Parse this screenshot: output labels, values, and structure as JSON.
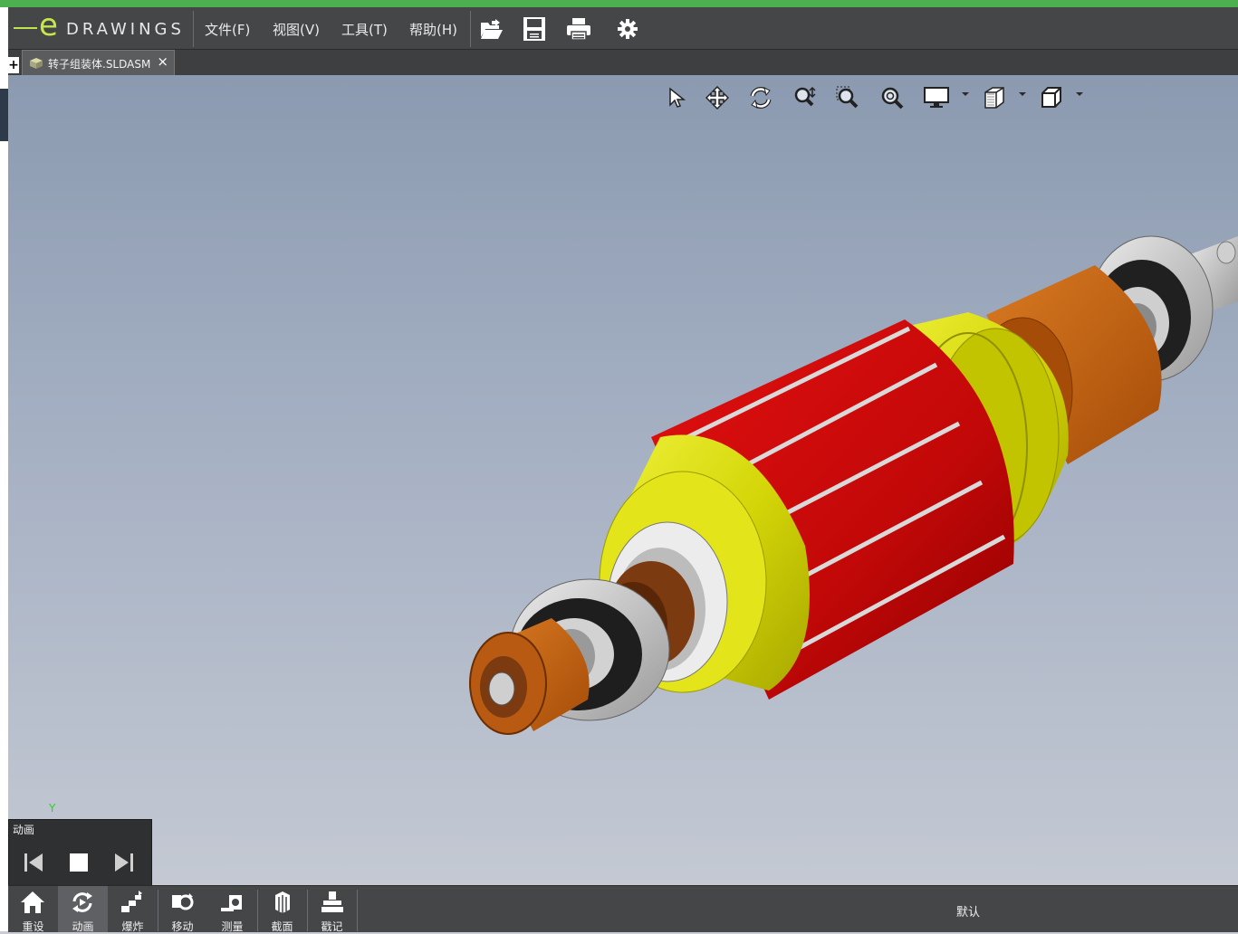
{
  "app": {
    "logo_text": "DRAWINGS",
    "logo_letter": "e"
  },
  "menu": {
    "items": [
      "文件(F)",
      "视图(V)",
      "工具(T)",
      "帮助(H)"
    ]
  },
  "toolbar": {
    "icons": [
      "open-icon",
      "save-icon",
      "print-icon",
      "settings-icon"
    ]
  },
  "tabs": {
    "add_label": "+",
    "items": [
      {
        "label": "转子组装体.SLDASM",
        "close": "×"
      }
    ]
  },
  "view_tools": [
    "select-icon",
    "pan-icon",
    "rotate-icon",
    "zoom-icon",
    "zoom-to-area-icon",
    "zoom-to-fit-icon",
    "display-style-icon",
    "shading-icon",
    "view-orientation-icon"
  ],
  "triad": {
    "y_label": "Y"
  },
  "animation_panel": {
    "title": "动画",
    "buttons": [
      "previous-icon",
      "stop-icon",
      "next-icon"
    ]
  },
  "bottom_tools": [
    {
      "label": "重设",
      "icon": "home-icon"
    },
    {
      "label": "动画",
      "icon": "animate-icon"
    },
    {
      "label": "爆炸",
      "icon": "explode-icon"
    },
    {
      "label": "移动",
      "icon": "move-icon"
    },
    {
      "label": "测量",
      "icon": "measure-icon"
    },
    {
      "label": "截面",
      "icon": "section-icon"
    },
    {
      "label": "戳记",
      "icon": "stamp-icon"
    }
  ],
  "configuration": "默认",
  "colors": {
    "accent": "#c6e64a",
    "bar": "#444648",
    "viewport_top": "#8b9ab0",
    "viewport_bottom": "#c4c9d3",
    "rotor_red": "#c8080a",
    "rotor_yellow": "#d8d80a",
    "copper": "#c4641a"
  }
}
